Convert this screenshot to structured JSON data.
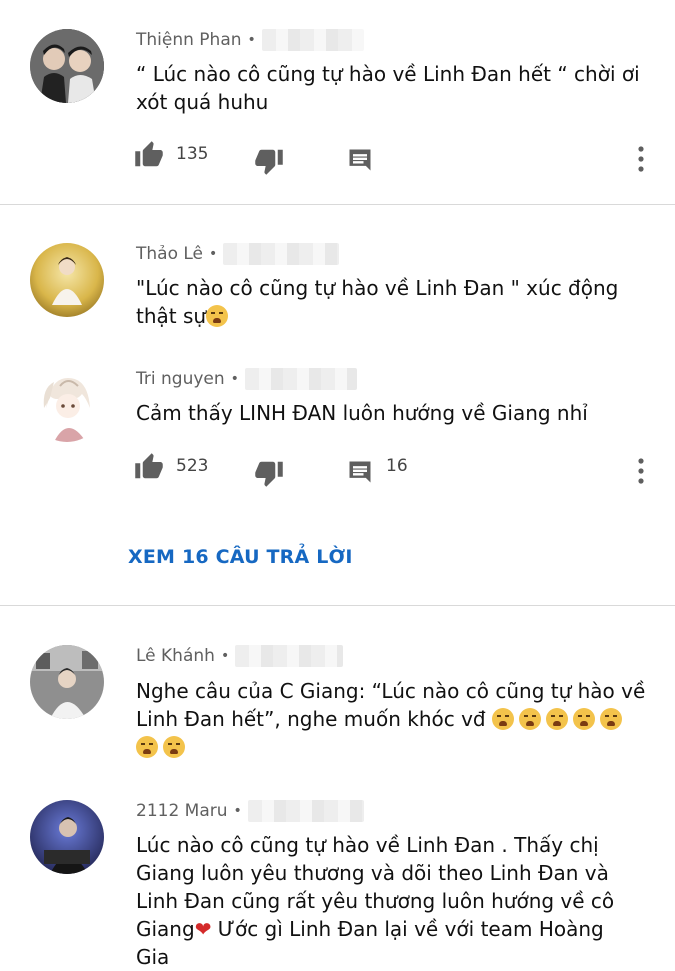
{
  "comments": [
    {
      "author": "Thiệnn Phan",
      "separator": "•",
      "text": "“ Lúc nào cô cũng tự hào về Linh Đan hết “ chời ơi xót quá huhu",
      "likes": "135",
      "avatar_icon": "avatar-photo-icon"
    },
    {
      "author": "Thảo Lê",
      "separator": "•",
      "text": "\"Lúc nào cô cũng tự hào về Linh Đan \" xúc động thật sự",
      "avatar_icon": "avatar-photo-icon"
    },
    {
      "author": "Tri nguyen",
      "separator": "•",
      "text": "Cảm thấy LINH ĐAN luôn hướng về Giang nhỉ",
      "likes": "523",
      "replies_count": "16",
      "avatar_icon": "avatar-anime-icon"
    },
    {
      "author": "Lê Khánh",
      "separator": "•",
      "text_line1": "Nghe câu của C Giang: “Lúc nào cô cũng tự hào về",
      "text_line2": "Linh Đan hết”, nghe muốn khóc vđ",
      "avatar_icon": "avatar-photo-icon"
    },
    {
      "author": "2112 Maru",
      "separator": "•",
      "text_line1": "Lúc nào cô cũng tự hào về Linh Đan . Thấy chị",
      "text_line2": "Giang luôn yêu thương và dõi theo Linh Đan và",
      "text_line3": "Linh Đan cũng rất yêu thương luôn hướng về cô",
      "text_line4a": "Giang",
      "text_line4b": " Ước gì Linh Đan lại về với team Hoàng",
      "text_line5": "Gia",
      "avatar_icon": "avatar-photo-icon"
    }
  ],
  "view_replies_label": "XEM 16 CÂU TRẢ LỜI",
  "colors": {
    "link_blue": "#1668c2",
    "meta_gray": "#606060",
    "icon_gray": "#606060",
    "divider": "#d9d9d9"
  }
}
